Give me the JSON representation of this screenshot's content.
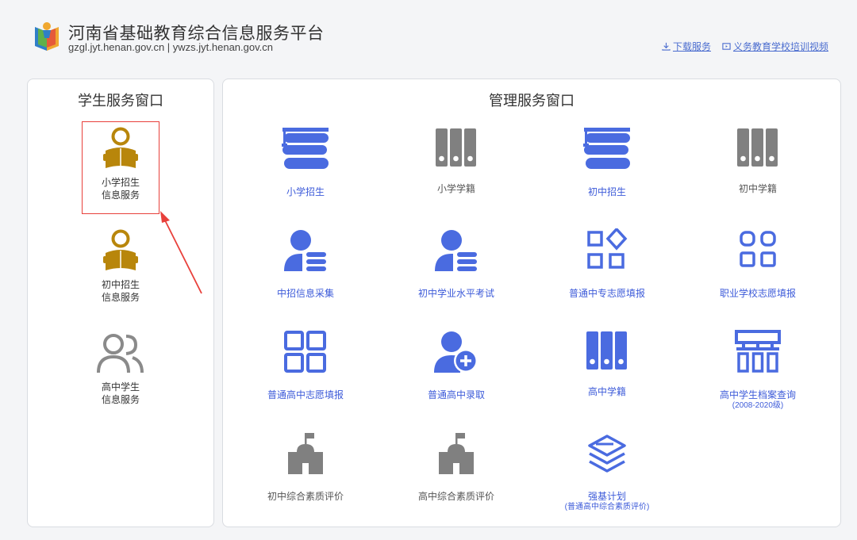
{
  "header": {
    "title": "河南省基础教育综合信息服务平台",
    "domains": "gzgl.jyt.henan.gov.cn | ywzs.jyt.henan.gov.cn",
    "links": [
      {
        "label": "下载服务",
        "icon": "download-icon"
      },
      {
        "label": "义务教育学校培训视频",
        "icon": "video-icon"
      }
    ]
  },
  "student_panel": {
    "title": "学生服务窗口",
    "items": [
      {
        "line1": "小学招生",
        "line2": "信息服务",
        "icon": "reader-icon",
        "selected": true
      },
      {
        "line1": "初中招生",
        "line2": "信息服务",
        "icon": "reader-icon"
      },
      {
        "line1": "高中学生",
        "line2": "信息服务",
        "icon": "users-icon"
      }
    ]
  },
  "manage_panel": {
    "title": "管理服务窗口",
    "items": [
      {
        "label": "小学招生",
        "icon": "graduation-books-icon",
        "color": "#4a6be0"
      },
      {
        "label": "小学学籍",
        "icon": "binders-icon",
        "color": "#808080"
      },
      {
        "label": "初中招生",
        "icon": "graduation-books-icon",
        "color": "#4a6be0"
      },
      {
        "label": "初中学籍",
        "icon": "binders-icon",
        "color": "#808080"
      },
      {
        "label": "中招信息采集",
        "icon": "user-list-icon",
        "color": "#4a6be0"
      },
      {
        "label": "初中学业水平考试",
        "icon": "user-list-icon",
        "color": "#4a6be0"
      },
      {
        "label": "普通中专志愿填报",
        "icon": "apps-diamond-icon",
        "color": "#4a6be0"
      },
      {
        "label": "职业学校志愿填报",
        "icon": "apps-grid-icon",
        "color": "#4a6be0"
      },
      {
        "label": "普通高中志愿填报",
        "icon": "grid-icon",
        "color": "#4a6be0"
      },
      {
        "label": "普通高中录取",
        "icon": "user-add-icon",
        "color": "#4a6be0"
      },
      {
        "label": "高中学籍",
        "icon": "binders-icon",
        "color": "#4a6be0"
      },
      {
        "label": "高中学生档案查询",
        "sub": "(2008-2020级)",
        "icon": "org-chart-icon",
        "color": "#4a6be0"
      },
      {
        "label": "初中综合素质评价",
        "icon": "school-icon",
        "color": "#808080"
      },
      {
        "label": "高中综合素质评价",
        "icon": "school-icon",
        "color": "#808080"
      },
      {
        "label": "强基计划",
        "sub": "(普通高中综合素质评价)",
        "icon": "layers-icon",
        "color": "#4a6be0"
      }
    ]
  },
  "colors": {
    "accent": "#3d5bd9",
    "selected_border": "#e8403b",
    "student_icon": "#b8860b"
  }
}
